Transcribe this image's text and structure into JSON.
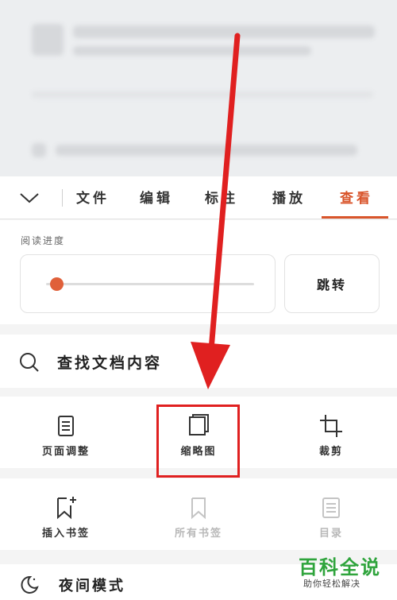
{
  "tabs": [
    {
      "label": "文件"
    },
    {
      "label": "编辑"
    },
    {
      "label": "标注"
    },
    {
      "label": "播放"
    },
    {
      "label": "查看",
      "active": true
    }
  ],
  "reading_progress": {
    "label": "阅读进度",
    "value": 0.05,
    "jump_label": "跳转"
  },
  "search": {
    "label": "查找文档内容"
  },
  "tools_row1": [
    {
      "label": "页面调整",
      "icon": "page-adjust-icon"
    },
    {
      "label": "缩略图",
      "icon": "thumbnail-icon",
      "highlighted": true
    },
    {
      "label": "裁剪",
      "icon": "crop-icon"
    }
  ],
  "tools_row2": [
    {
      "label": "插入书签",
      "icon": "bookmark-add-icon"
    },
    {
      "label": "所有书签",
      "icon": "bookmark-icon",
      "disabled": true
    },
    {
      "label": "目录",
      "icon": "toc-icon",
      "disabled": true
    }
  ],
  "night_mode": {
    "label": "夜间模式"
  },
  "watermark": {
    "title": "百科全说",
    "subtitle": "助你轻松解决"
  },
  "colors": {
    "accent": "#d9552b",
    "annotation": "#e02020",
    "watermark": "#2fa43c"
  }
}
